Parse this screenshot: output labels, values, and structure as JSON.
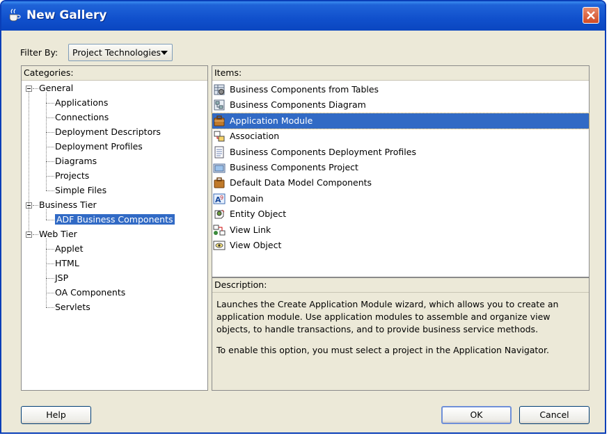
{
  "window": {
    "title": "New Gallery"
  },
  "filter": {
    "label": "Filter By:",
    "value": "Project Technologies"
  },
  "categories": {
    "header": "Categories:",
    "groups": [
      {
        "label": "General",
        "children": [
          "Applications",
          "Connections",
          "Deployment Descriptors",
          "Deployment Profiles",
          "Diagrams",
          "Projects",
          "Simple Files"
        ]
      },
      {
        "label": "Business Tier",
        "children": [
          "ADF Business Components"
        ]
      },
      {
        "label": "Web Tier",
        "children": [
          "Applet",
          "HTML",
          "JSP",
          "OA Components",
          "Servlets"
        ]
      }
    ],
    "selected": "ADF Business Components"
  },
  "items": {
    "header": "Items:",
    "list": [
      {
        "label": "Business Components from Tables",
        "icon": "bc-tables-icon"
      },
      {
        "label": "Business Components Diagram",
        "icon": "bc-diagram-icon"
      },
      {
        "label": "Application Module",
        "icon": "application-module-icon"
      },
      {
        "label": "Association",
        "icon": "association-icon"
      },
      {
        "label": "Business Components Deployment Profiles",
        "icon": "deployment-profiles-icon"
      },
      {
        "label": "Business Components Project",
        "icon": "bc-project-icon"
      },
      {
        "label": "Default Data Model Components",
        "icon": "data-model-icon"
      },
      {
        "label": "Domain",
        "icon": "domain-icon"
      },
      {
        "label": "Entity Object",
        "icon": "entity-object-icon"
      },
      {
        "label": "View Link",
        "icon": "view-link-icon"
      },
      {
        "label": "View Object",
        "icon": "view-object-icon"
      }
    ],
    "selected": "Application Module"
  },
  "description": {
    "header": "Description:",
    "p1": "Launches the Create Application Module wizard, which allows you to create an application module. Use application modules to assemble and organize view objects, to handle transactions, and to provide business service methods.",
    "p2": "To enable this option, you must select a project in the Application Navigator."
  },
  "buttons": {
    "help": "Help",
    "ok": "OK",
    "cancel": "Cancel"
  },
  "colors": {
    "selection": "#316ac5",
    "titlebar": "#0a46c0",
    "dialog_bg": "#ece9d8"
  }
}
